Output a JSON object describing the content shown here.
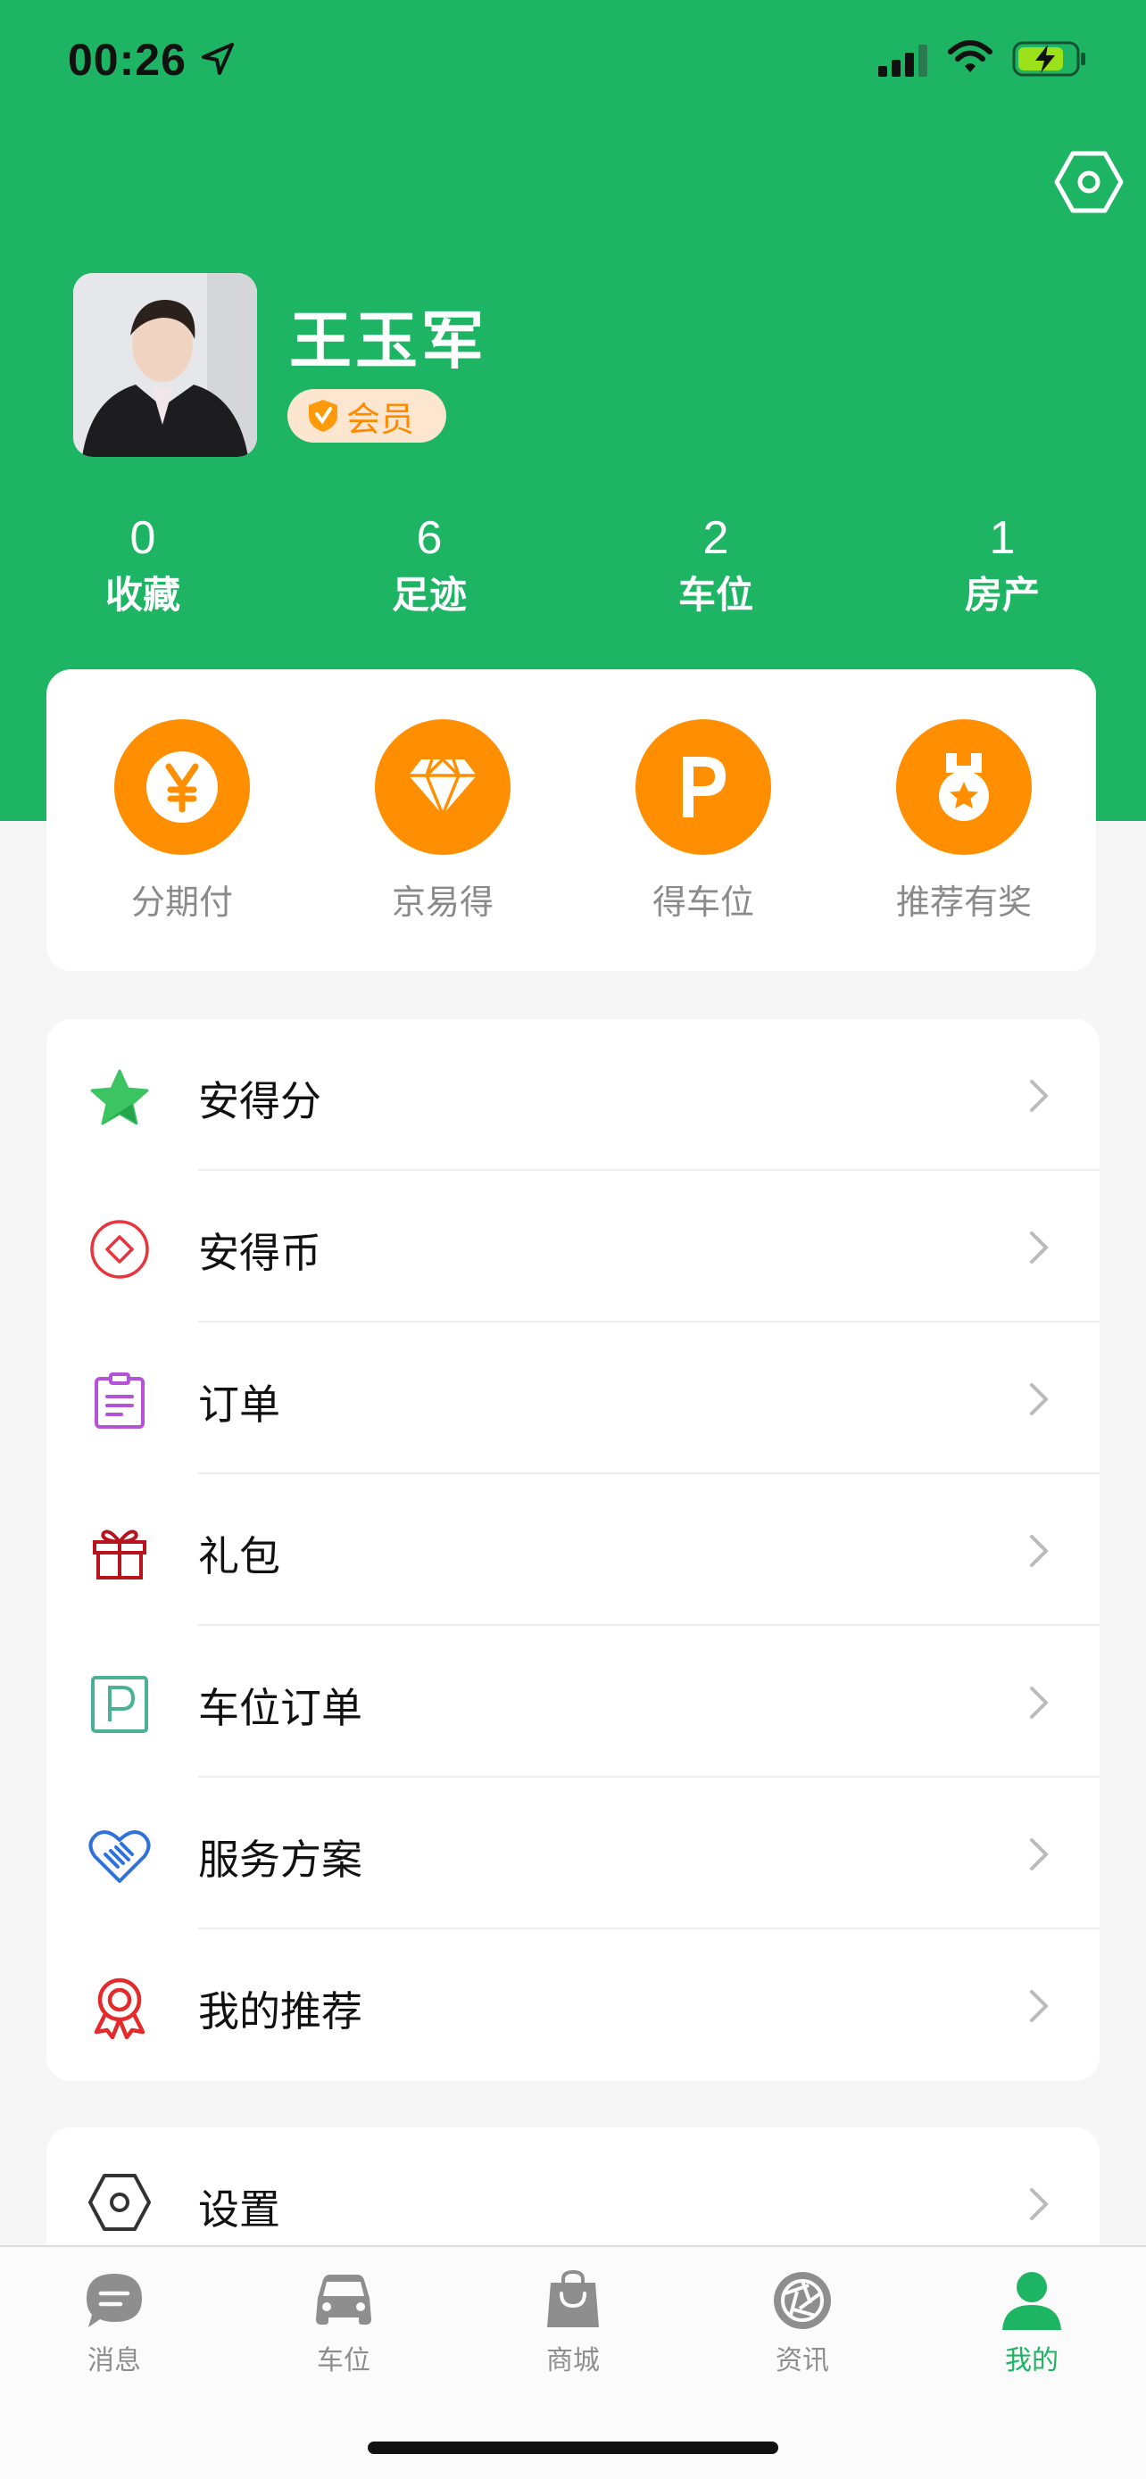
{
  "status_bar": {
    "time": "00:26"
  },
  "colors": {
    "brand_green": "#1db463",
    "accent_orange": "#ff8f00",
    "background": "#f6f6f6"
  },
  "profile": {
    "name": "王玉军",
    "badge": "会员"
  },
  "stats": [
    {
      "value": "0",
      "label": "收藏"
    },
    {
      "value": "6",
      "label": "足迹"
    },
    {
      "value": "2",
      "label": "车位"
    },
    {
      "value": "1",
      "label": "房产"
    }
  ],
  "quick_actions": [
    {
      "label": "分期付",
      "icon": "yuan-icon"
    },
    {
      "label": "京易得",
      "icon": "diamond-icon"
    },
    {
      "label": "得车位",
      "icon": "parking-icon"
    },
    {
      "label": "推荐有奖",
      "icon": "medal-icon"
    }
  ],
  "menu": [
    {
      "label": "安得分",
      "icon": "star-icon"
    },
    {
      "label": "安得币",
      "icon": "coin-icon"
    },
    {
      "label": "订单",
      "icon": "clipboard-icon"
    },
    {
      "label": "礼包",
      "icon": "gift-icon"
    },
    {
      "label": "车位订单",
      "icon": "parking-order-icon"
    },
    {
      "label": "服务方案",
      "icon": "handshake-heart-icon"
    },
    {
      "label": "我的推荐",
      "icon": "award-ribbon-icon"
    }
  ],
  "settings_item": {
    "label": "设置",
    "icon": "settings-icon"
  },
  "tabs": [
    {
      "label": "消息",
      "icon": "chat-bubble-icon",
      "active": false
    },
    {
      "label": "车位",
      "icon": "car-icon",
      "active": false
    },
    {
      "label": "商城",
      "icon": "shopping-bag-icon",
      "active": false
    },
    {
      "label": "资讯",
      "icon": "aperture-icon",
      "active": false
    },
    {
      "label": "我的",
      "icon": "person-icon",
      "active": true
    }
  ]
}
